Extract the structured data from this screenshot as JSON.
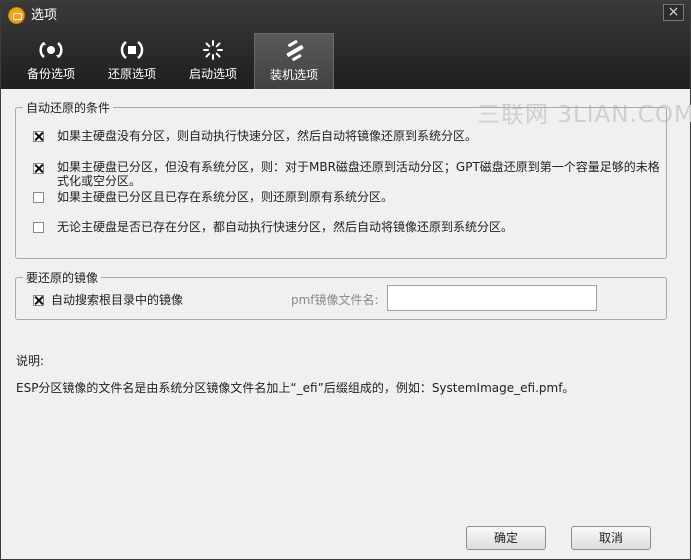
{
  "window": {
    "title": "选项",
    "close_glyph": "×"
  },
  "tabs": [
    {
      "label": "备份选项",
      "icon": "backup-icon",
      "active": false
    },
    {
      "label": "还原选项",
      "icon": "restore-icon",
      "active": false
    },
    {
      "label": "启动选项",
      "icon": "startup-icon",
      "active": false
    },
    {
      "label": "装机选项",
      "icon": "tools-icon",
      "active": true
    }
  ],
  "watermark": "三联网 3LIAN.COM",
  "auto_restore_group": {
    "legend": "自动还原的条件",
    "options": [
      {
        "label": "如果主硬盘没有分区，则自动执行快速分区，然后自动将镜像还原到系统分区。",
        "checked": true
      },
      {
        "label_line1": "如果主硬盘已分区，但没有系统分区，则：对于MBR磁盘还原到活动分区；GPT磁盘还原到第一个容量足够的未格",
        "label_line2": "式化或空分区。",
        "checked": true
      },
      {
        "label": "如果主硬盘已分区且已存在系统分区，则还原到原有系统分区。",
        "checked": false
      },
      {
        "label": "无论主硬盘是否已存在分区，都自动执行快速分区，然后自动将镜像还原到系统分区。",
        "checked": false
      }
    ]
  },
  "image_group": {
    "legend": "要还原的镜像",
    "auto_search_label": "自动搜索根目录中的镜像",
    "auto_search_checked": true,
    "pmf_label": "pmf镜像文件名:",
    "pmf_value": ""
  },
  "notes": {
    "heading": "说明:",
    "text": "ESP分区镜像的文件名是由系统分区镜像文件名加上“_efi”后缀组成的，例如：SystemImage_efi.pmf。"
  },
  "buttons": {
    "ok": "确定",
    "cancel": "取消"
  }
}
